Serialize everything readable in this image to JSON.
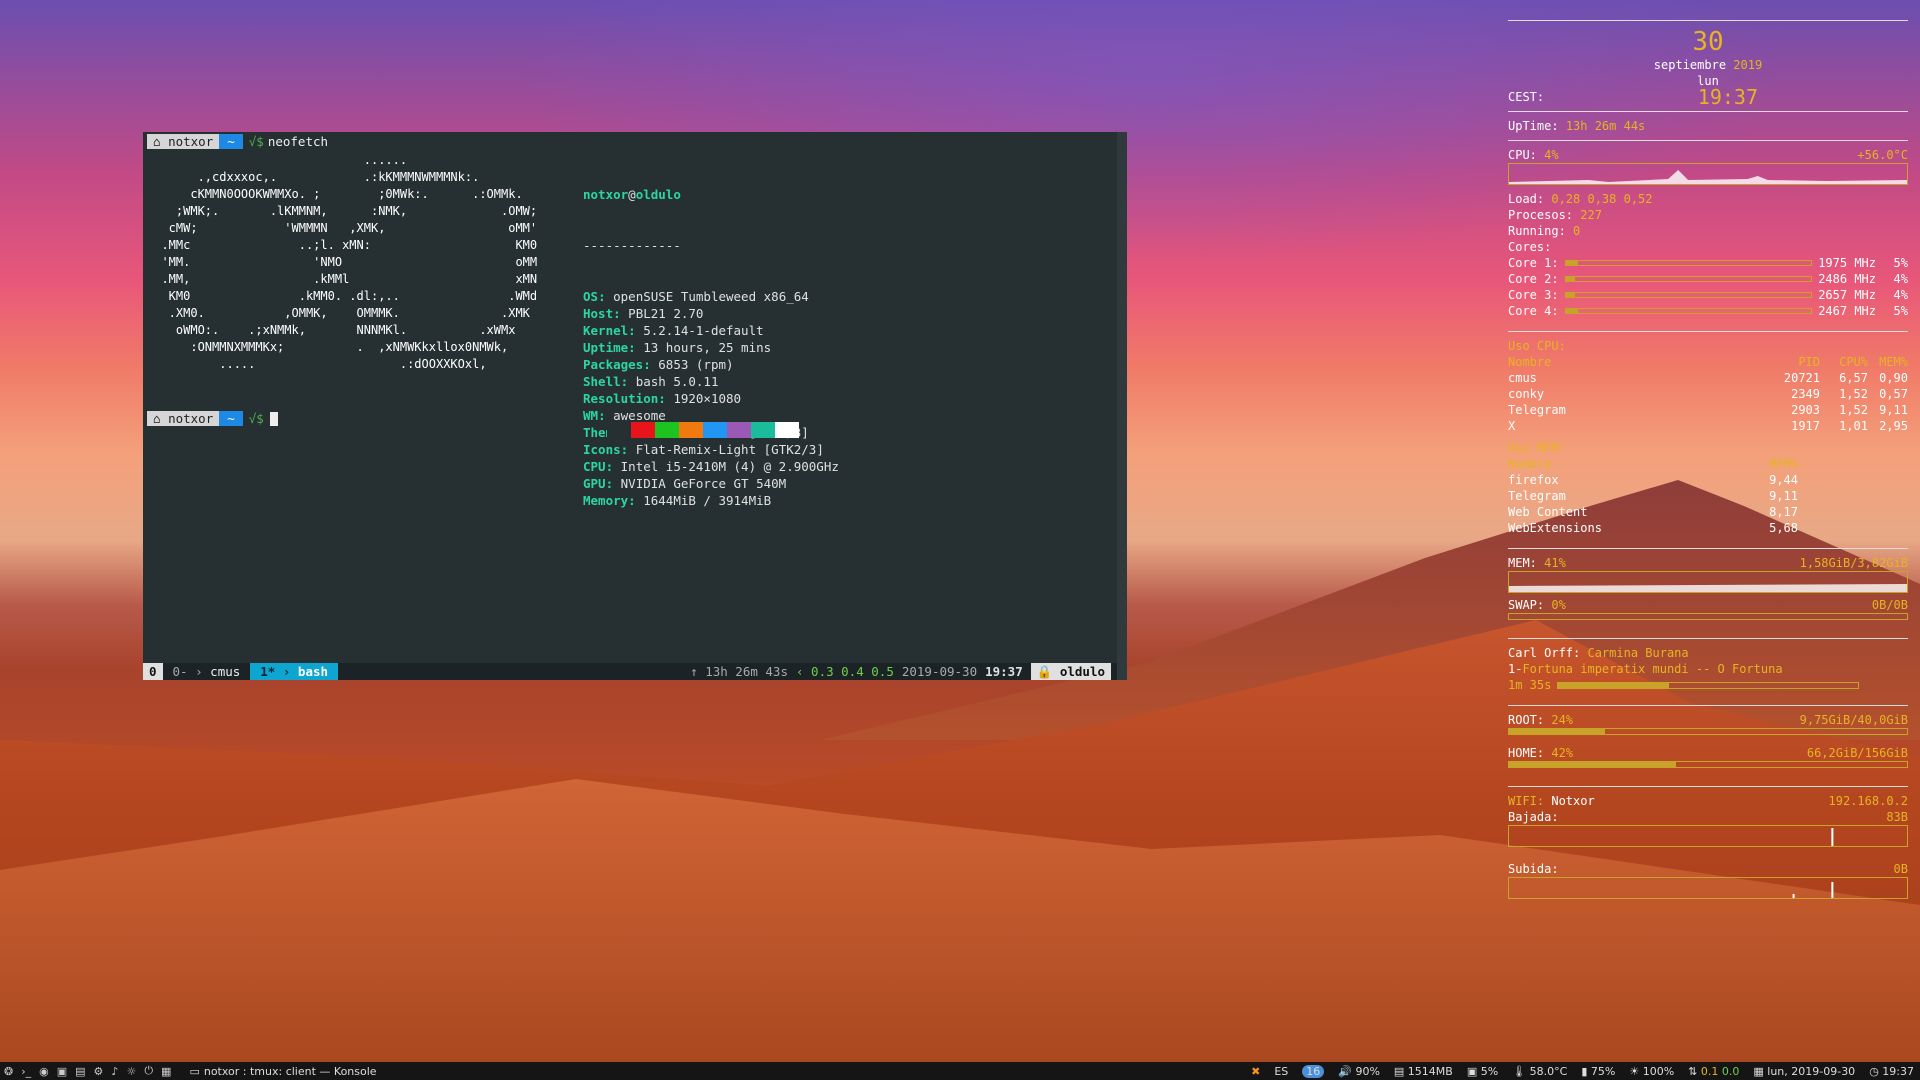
{
  "terminal": {
    "user": "notxor",
    "dir": "~",
    "check": "√$",
    "command": "neofetch",
    "ascii_art": "                              ......\n       .,cdxxxoc,.            .:kKMMMNWMMMNk:.\n      cKMMN0OOOKWMMXo. ;        ;0MWk:.      .:OMMk.\n    ;WMK;.       .lKMMNM,      :NMK,             .OMW;\n   cMW;            'WMMMN   ,XMK,                 oMM'\n  .MMc               ..;l. xMN:                    KM0\n  'MM.                 'NMO                        oMM\n  .MM,                 .kMMl                       xMN\n   KM0               .kMM0. .dl:,..               .WMd\n   .XM0.           ,OMMK,    OMMMK.              .XMK\n    oWMO:.    .;xNMMk,       NNNMKl.          .xWMx\n      :ONMMNXMMMKx;          .  ,xNMWKkxllox0NMWk,\n          .....                    .:dOOXXKOxl,",
    "info_user": "notxor",
    "info_host": "oldulo",
    "info_sep": "-------------",
    "info": [
      {
        "key": "OS",
        "value": "openSUSE Tumbleweed x86_64"
      },
      {
        "key": "Host",
        "value": "PBL21 2.70"
      },
      {
        "key": "Kernel",
        "value": "5.2.14-1-default"
      },
      {
        "key": "Uptime",
        "value": "13 hours, 25 mins"
      },
      {
        "key": "Packages",
        "value": "6853 (rpm)"
      },
      {
        "key": "Shell",
        "value": "bash 5.0.11"
      },
      {
        "key": "Resolution",
        "value": "1920×1080"
      },
      {
        "key": "WM",
        "value": "awesome"
      },
      {
        "key": "Theme",
        "value": "Flat-Remix-GTK [GTK2/3]"
      },
      {
        "key": "Icons",
        "value": "Flat-Remix-Light [GTK2/3]"
      },
      {
        "key": "CPU",
        "value": "Intel i5-2410M (4) @ 2.900GHz"
      },
      {
        "key": "GPU",
        "value": "NVIDIA GeForce GT 540M"
      },
      {
        "key": "Memory",
        "value": "1644MiB / 3914MiB"
      }
    ],
    "palette": [
      "#263033",
      "#e8141c",
      "#1dc321",
      "#f07a10",
      "#2196f3",
      "#9b59b6",
      "#1abc9c",
      "#ffffff"
    ],
    "status": {
      "session": "0",
      "win0": "0-",
      "win0_name": "cmus",
      "win1": "1*",
      "win1_name": "bash",
      "uptime": "13h 26m 43s",
      "load1": "0.3",
      "load2": "0.4",
      "load3": "0.5",
      "date": "2019-09-30",
      "time": "19:37",
      "host": "oldulo"
    }
  },
  "conky": {
    "day": "30",
    "month": "septiembre",
    "year": "2019",
    "weekday": "lun",
    "tz_label": "CEST:",
    "time": "19:37",
    "uptime_label": "UpTime:",
    "uptime": "13h 26m 44s",
    "cpu_label": "CPU:",
    "cpu_pct": "4%",
    "cpu_temp": "+56.0°C",
    "load_label": "Load:",
    "load": "0,28 0,38 0,52",
    "procs_label": "Procesos:",
    "procs": "227",
    "running_label": "Running:",
    "running": "0",
    "cores_label": "Cores:",
    "cores": [
      {
        "label": "Core 1:",
        "freq": "1975 MHz",
        "pct": "5%",
        "level": 0.05
      },
      {
        "label": "Core 2:",
        "freq": "2486 MHz",
        "pct": "4%",
        "level": 0.04
      },
      {
        "label": "Core 3:",
        "freq": "2657 MHz",
        "pct": "4%",
        "level": 0.04
      },
      {
        "label": "Core 4:",
        "freq": "2467 MHz",
        "pct": "5%",
        "level": 0.05
      }
    ],
    "cpu_use_title": "Uso CPU:",
    "cpu_cols": [
      "Nombre",
      "PID",
      "CPU%",
      "MEM%"
    ],
    "cpu_rows": [
      [
        "cmus",
        "20721",
        "6,57",
        "0,90"
      ],
      [
        "conky",
        "2349",
        "1,52",
        "0,57"
      ],
      [
        "Telegram",
        "2903",
        "1,52",
        "9,11"
      ],
      [
        "X",
        "1917",
        "1,01",
        "2,95"
      ]
    ],
    "mem_use_title": "Uso MEM:",
    "mem_cols": [
      "Nombre",
      "MEM%"
    ],
    "mem_rows": [
      [
        "firefox",
        "9,44"
      ],
      [
        "Telegram",
        "9,11"
      ],
      [
        "Web Content",
        "8,17"
      ],
      [
        "WebExtensions",
        "5,68"
      ]
    ],
    "mem_label": "MEM:",
    "mem_pct": "41%",
    "mem_used": "1,58GiB/3,82GiB",
    "swap_label": "SWAP:",
    "swap_pct": "0%",
    "swap_used": "0B/0B",
    "artist": "Carl Orff:",
    "album": "Carmina Burana",
    "track_no": "1-",
    "track": "Fortuna imperatix mundi -- O Fortuna",
    "position": "1m 35s",
    "track_progress": 0.37,
    "root_label": "ROOT:",
    "root_pct": "24%",
    "root_used": "9,75GiB/40,0GiB",
    "root_level": 0.24,
    "home_label": "HOME:",
    "home_pct": "42%",
    "home_used": "66,2GiB/156GiB",
    "home_level": 0.42,
    "wifi_label": "WIFI:",
    "wifi_name": "Notxor",
    "ip": "192.168.0.2",
    "down_label": "Bajada:",
    "down": "83B",
    "up_label": "Subida:",
    "up": "0B"
  },
  "taskbar": {
    "task_title": "notxor : tmux: client — Konsole",
    "lang": "ES",
    "badge": "16",
    "volume": "90%",
    "mem": "1514MB",
    "cpu": "5%",
    "temp": "58.0°C",
    "battery": "75%",
    "brightness": "100%",
    "net": "0.1",
    "net2": "0.0",
    "date": "lun, 2019-09-30",
    "time": "19:37"
  },
  "colors": {
    "accent": "#e6b422",
    "terminal_bg": "#263033",
    "teal": "#2bd6a2"
  }
}
